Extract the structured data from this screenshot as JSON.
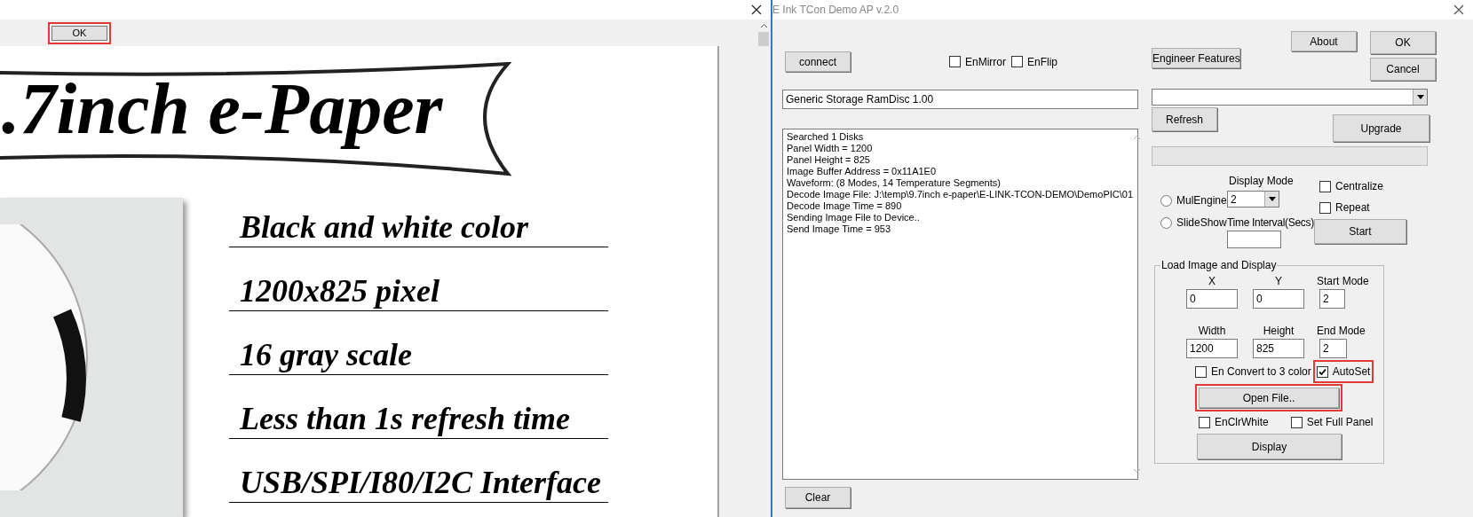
{
  "left_window": {
    "toolbar": {
      "ok_button": {
        "label": "OK",
        "highlighted": true
      }
    },
    "document": {
      "banner_title": ".7inch e-Paper",
      "features": [
        "Black and white color",
        "1200x825 pixel",
        "16 gray scale",
        "Less than 1s refresh time",
        "USB/SPI/I80/I2C Interface"
      ]
    }
  },
  "right_window": {
    "title": "E Ink TCon Demo AP v.2.0",
    "connect_button": "connect",
    "options": [
      {
        "label": "EnMirror",
        "checked": false
      },
      {
        "label": "EnFlip",
        "checked": false
      }
    ],
    "engineer_button": "Engineer Features",
    "about_button": "About",
    "ok_button": "OK",
    "cancel_button": "Cancel",
    "device_field": "Generic Storage RamDisc 1.00",
    "refresh_button": "Refresh",
    "upgrade_button": "Upgrade",
    "log": [
      "Searched 1 Disks",
      "Panel Width = 1200",
      "Panel Height = 825",
      "Image Buffer Address = 0x11A1E0",
      "Waveform: (8 Modes, 14 Temperature Segments)",
      "Decode Image File: J:\\temp\\9.7inch e-paper\\E-LINK-TCON-DEMO\\DemoPIC\\01",
      "Decode Image Time = 890",
      "Sending Image File to Device..",
      "Send Image Time = 953"
    ],
    "clear_button": "Clear",
    "modes": [
      {
        "label": "MulEngine",
        "selected": false
      },
      {
        "label": "SlideShow",
        "selected": false
      }
    ],
    "display_mode_label": "Display Mode",
    "display_mode": "2",
    "interval_label": "Time Interval(Secs)",
    "toggles": [
      {
        "label": "Centralize",
        "checked": false
      },
      {
        "label": "Repeat",
        "checked": false
      }
    ],
    "start_button": "Start",
    "load_group": {
      "title": "Load Image and Display",
      "fields": [
        {
          "label": "X",
          "value": "0"
        },
        {
          "label": "Y",
          "value": "0"
        },
        {
          "label": "Start Mode",
          "value": "2"
        },
        {
          "label": "Width",
          "value": "1200"
        },
        {
          "label": "Height",
          "value": "825"
        },
        {
          "label": "End Mode",
          "value": "2"
        }
      ],
      "convert": {
        "label": "En Convert to 3 color",
        "checked": false
      },
      "autoset": {
        "label": "AutoSet",
        "checked": true,
        "highlighted": true
      },
      "open_button": {
        "label": "Open File..",
        "highlighted": true
      },
      "options": [
        {
          "label": "EnClrWhite",
          "checked": false
        },
        {
          "label": "Set Full Panel",
          "checked": false
        }
      ],
      "display_button": "Display"
    }
  }
}
